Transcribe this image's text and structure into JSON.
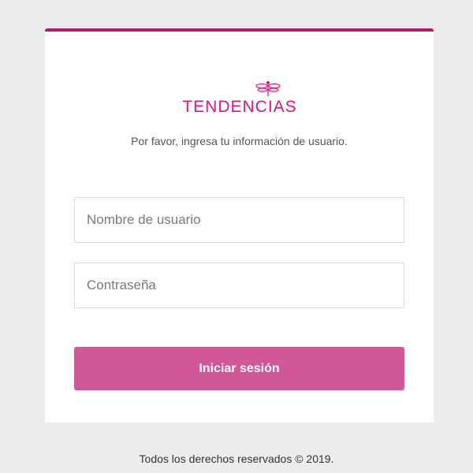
{
  "brand": {
    "name": "TENDENCIAS",
    "color": "#e3157f"
  },
  "login": {
    "instructions": "Por favor, ingresa tu información de usuario.",
    "username_placeholder": "Nombre de usuario",
    "password_placeholder": "Contraseña",
    "submit_label": "Iniciar sesión"
  },
  "footer": {
    "copyright": "Todos los derechos reservados © 2019."
  },
  "colors": {
    "accent_top_border": "#b8176a",
    "button_background": "#d05898",
    "page_background": "#ececec"
  }
}
